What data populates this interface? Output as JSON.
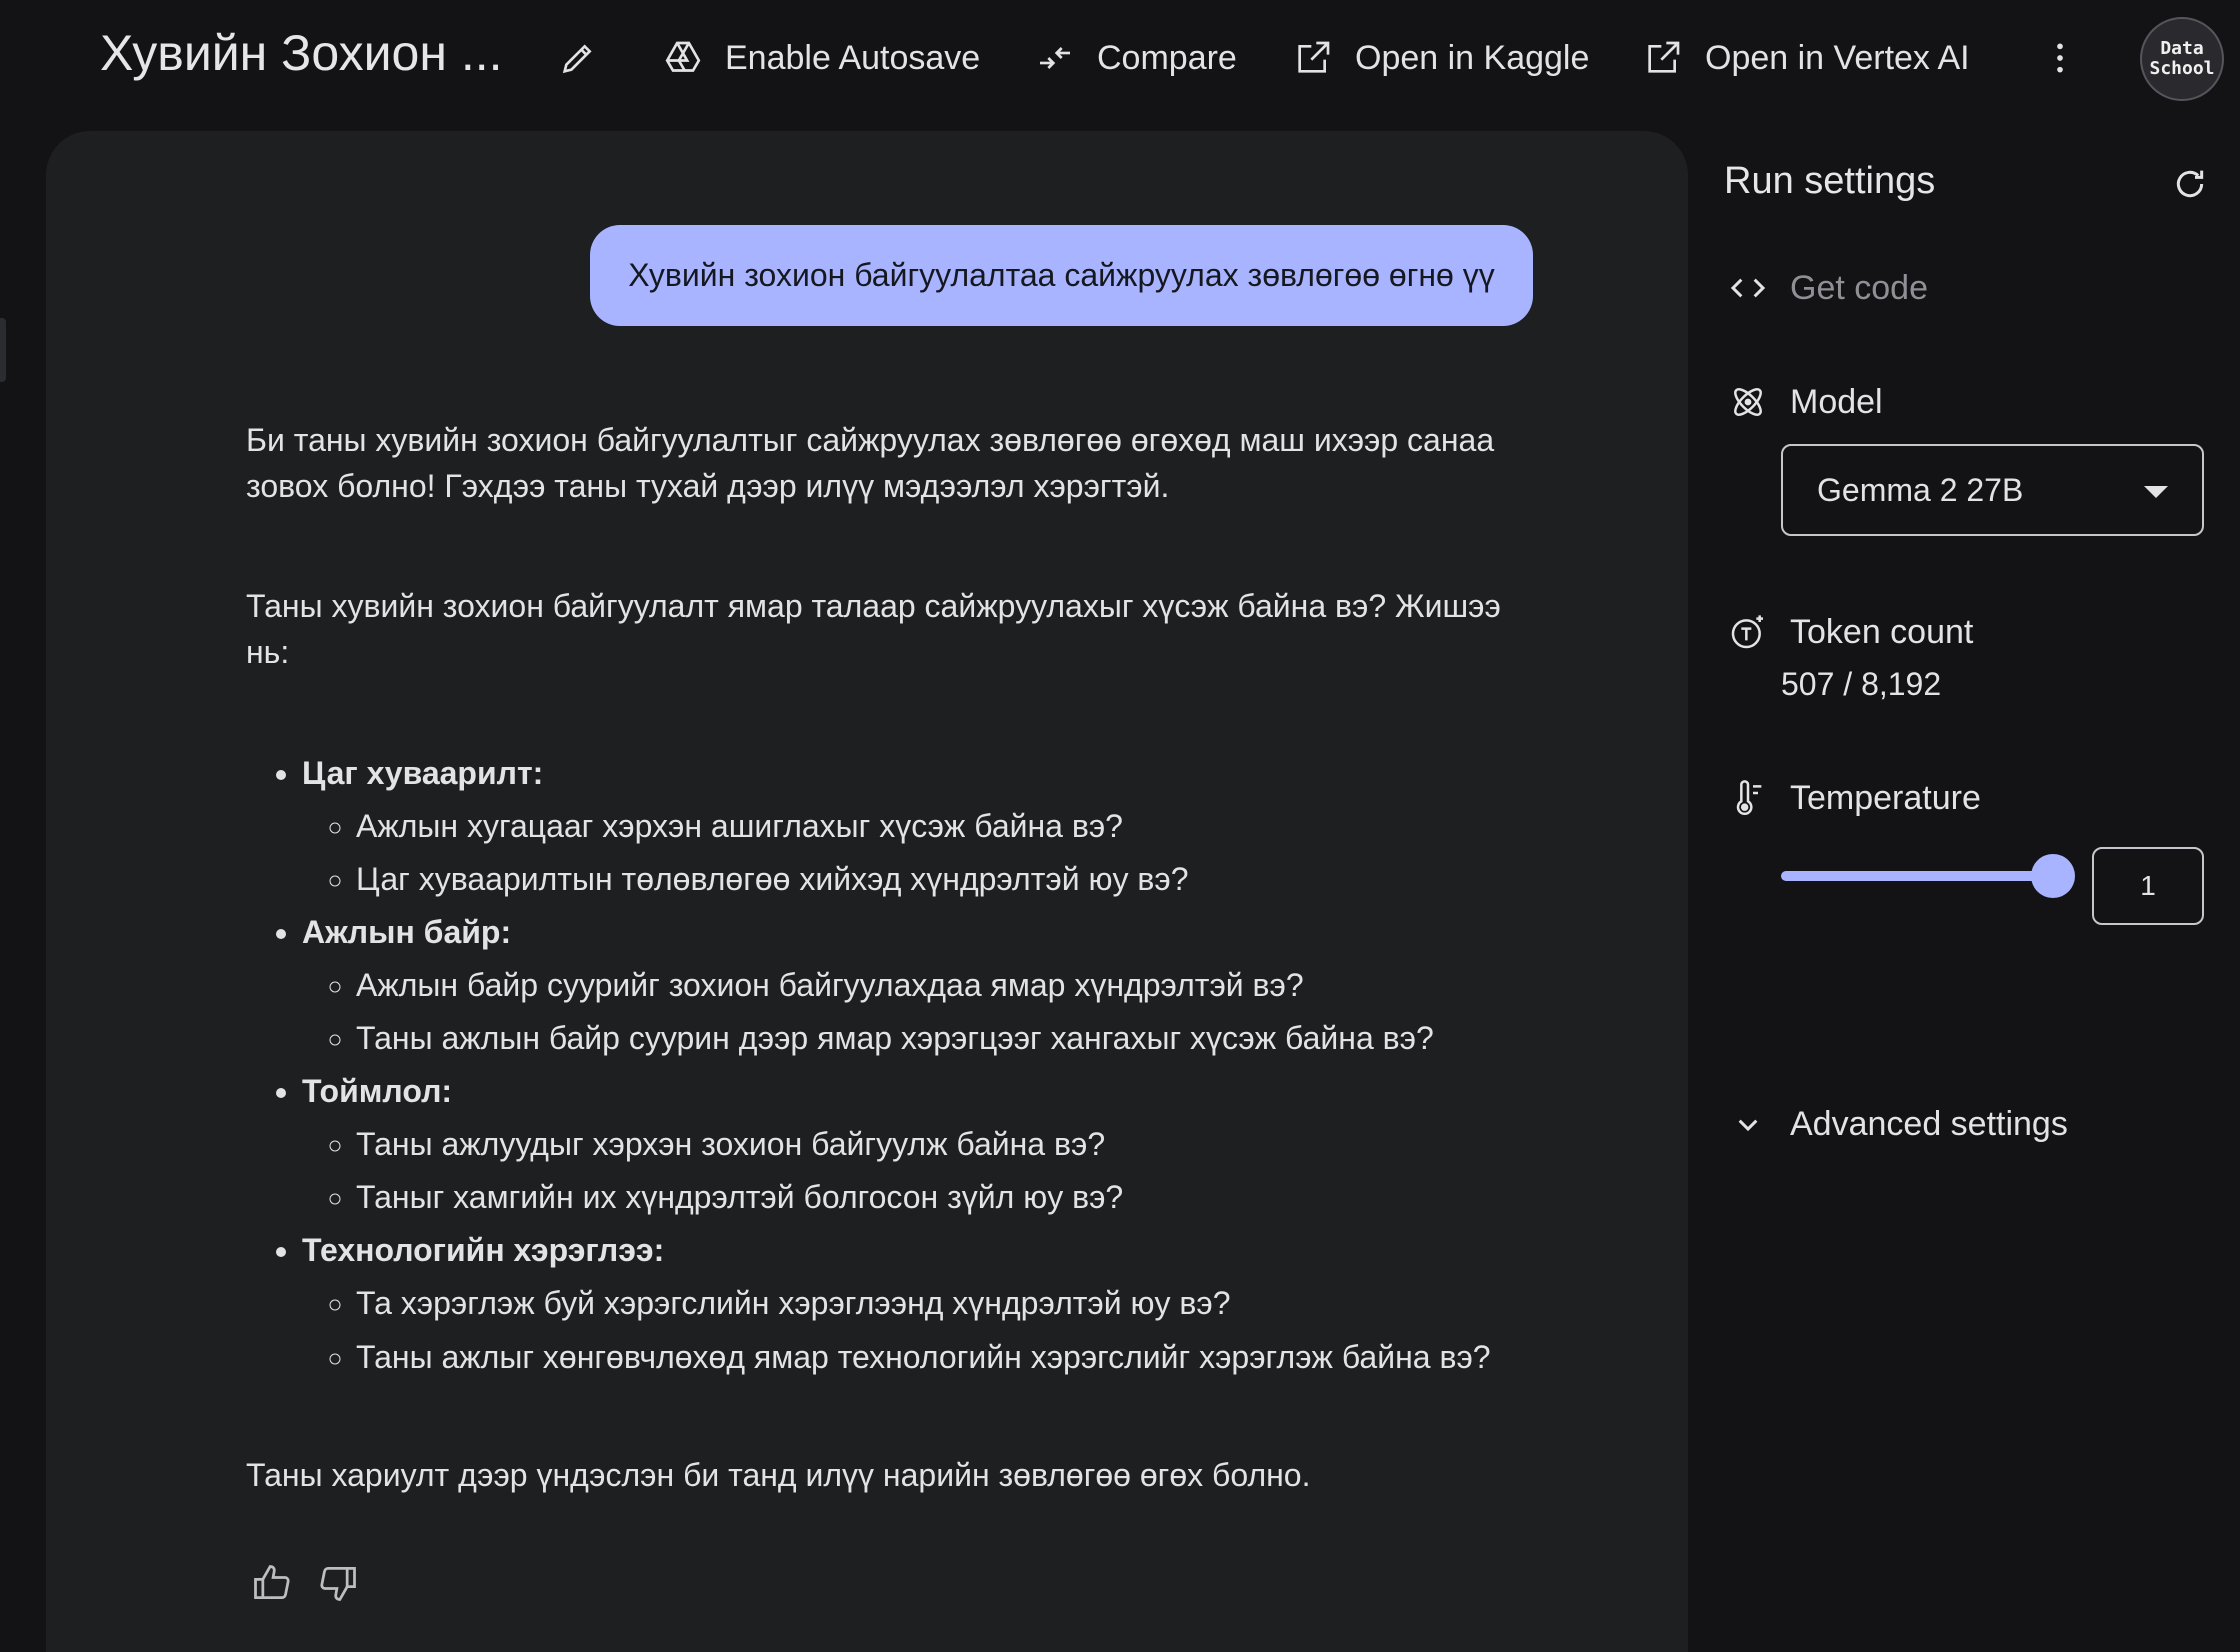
{
  "header": {
    "title": "Хувийн Зохион ...",
    "autosave_label": "Enable Autosave",
    "compare_label": "Compare",
    "kaggle_label": "Open in Kaggle",
    "vertex_label": "Open in Vertex AI",
    "avatar_line1": "Data",
    "avatar_line2": "School"
  },
  "chat": {
    "user_message": "Хувийн зохион байгуулалтаа сайжруулах зөвлөгөө өгнө үү",
    "response": {
      "intro": "Би таны хувийн зохион байгуулалтыг сайжруулах зөвлөгөө өгөхөд маш ихээр санаа зовох болно! Гэхдээ таны тухай дээр илүү мэдээлэл хэрэгтэй.",
      "question": "Таны хувийн зохион байгуулалт ямар талаар сайжруулахыг хүсэж байна вэ? Жишээ нь:",
      "categories": [
        {
          "title": "Цаг хуваарилт:",
          "items": [
            "Ажлын хугацааг хэрхэн ашиглахыг хүсэж байна вэ?",
            "Цаг хуваарилтын төлөвлөгөө хийхэд хүндрэлтэй юу вэ?"
          ]
        },
        {
          "title": "Ажлын байр:",
          "items": [
            "Ажлын байр суурийг зохион байгуулахдаа ямар хүндрэлтэй вэ?",
            "Таны ажлын байр суурин дээр ямар хэрэгцээг хангахыг хүсэж байна вэ?"
          ]
        },
        {
          "title": "Тоймлол:",
          "items": [
            "Таны ажлуудыг хэрхэн зохион байгуулж байна вэ?",
            "Таныг хамгийн их хүндрэлтэй болгосон зүйл юу вэ?"
          ]
        },
        {
          "title": "Технологийн хэрэглээ:",
          "items": [
            "Та хэрэглэж буй хэрэгслийн хэрэглээнд хүндрэлтэй юу вэ?",
            "Таны ажлыг хөнгөвчлөхөд ямар технологийн хэрэгслийг хэрэглэж байна вэ?"
          ]
        }
      ],
      "closing": "Таны хариулт дээр үндэслэн би танд илүү нарийн зөвлөгөө өгөх болно."
    }
  },
  "settings": {
    "title": "Run settings",
    "get_code_label": "Get code",
    "model_label": "Model",
    "model_value": "Gemma 2 27B",
    "token_label": "Token count",
    "token_value": "507 / 8,192",
    "temperature_label": "Temperature",
    "temperature_value": "1",
    "temperature_fraction": 1.0,
    "advanced_label": "Advanced settings"
  },
  "colors": {
    "accent": "#a8b4ff",
    "background": "#131316",
    "panel": "#1e1f20"
  }
}
